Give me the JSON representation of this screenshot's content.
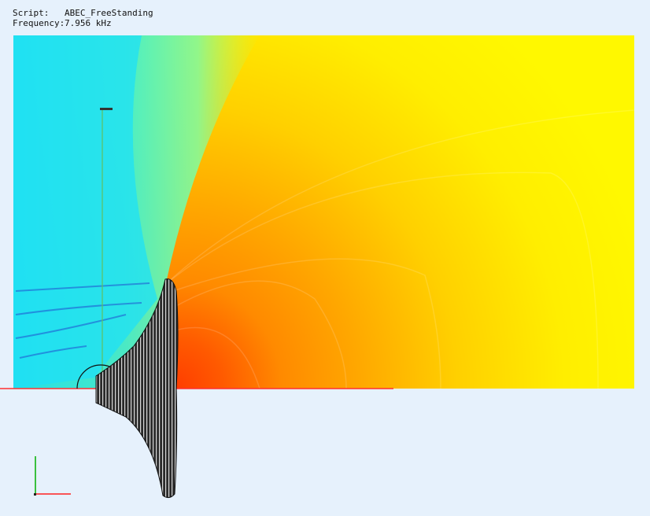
{
  "script": {
    "label": "Script:",
    "value": "ABEC_FreeStanding"
  },
  "frequency": {
    "label": "Frequency:",
    "value": "7.956 kHz"
  },
  "colors": {
    "background": "#e6f1fc",
    "field_low": "#1fe8f5",
    "field_mid": "#d8ff3a",
    "field_high": "#ff4a00",
    "symmetry_axis": "#ff3030",
    "axis_x": "#ff2020",
    "axis_y": "#00b000",
    "horn_body": "#1a1a1a",
    "probe_line": "#60c060"
  },
  "icons": {
    "axis_triad": "xy-axes-icon",
    "horn": "horn-mesh-icon"
  }
}
